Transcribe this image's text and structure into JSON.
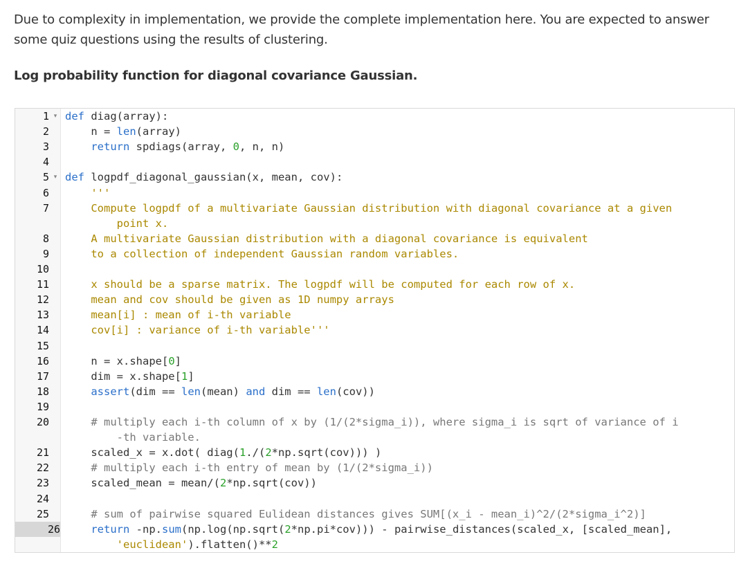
{
  "intro": {
    "line1": "Due to complexity in implementation, we provide the complete implementation here. You are expected to answer",
    "line2": "some quiz questions using the results of clustering."
  },
  "section_title": "Log probability function for diagonal covariance Gaussian.",
  "editor": {
    "active_line": "26",
    "lines": [
      {
        "n": "1",
        "fold": "▾",
        "text": "def diag(array):"
      },
      {
        "n": "2",
        "fold": "",
        "text": "    n = len(array)"
      },
      {
        "n": "3",
        "fold": "",
        "text": "    return spdiags(array, 0, n, n)"
      },
      {
        "n": "4",
        "fold": "",
        "text": ""
      },
      {
        "n": "5",
        "fold": "▾",
        "text": "def logpdf_diagonal_gaussian(x, mean, cov):"
      },
      {
        "n": "6",
        "fold": "",
        "text": "    '''"
      },
      {
        "n": "7",
        "fold": "",
        "text": "    Compute logpdf of a multivariate Gaussian distribution with diagonal covariance at a given"
      },
      {
        "n": "",
        "fold": "",
        "text": "        point x."
      },
      {
        "n": "8",
        "fold": "",
        "text": "    A multivariate Gaussian distribution with a diagonal covariance is equivalent"
      },
      {
        "n": "9",
        "fold": "",
        "text": "    to a collection of independent Gaussian random variables."
      },
      {
        "n": "10",
        "fold": "",
        "text": ""
      },
      {
        "n": "11",
        "fold": "",
        "text": "    x should be a sparse matrix. The logpdf will be computed for each row of x."
      },
      {
        "n": "12",
        "fold": "",
        "text": "    mean and cov should be given as 1D numpy arrays"
      },
      {
        "n": "13",
        "fold": "",
        "text": "    mean[i] : mean of i-th variable"
      },
      {
        "n": "14",
        "fold": "",
        "text": "    cov[i] : variance of i-th variable'''"
      },
      {
        "n": "15",
        "fold": "",
        "text": ""
      },
      {
        "n": "16",
        "fold": "",
        "text": "    n = x.shape[0]"
      },
      {
        "n": "17",
        "fold": "",
        "text": "    dim = x.shape[1]"
      },
      {
        "n": "18",
        "fold": "",
        "text": "    assert(dim == len(mean) and dim == len(cov))"
      },
      {
        "n": "19",
        "fold": "",
        "text": ""
      },
      {
        "n": "20",
        "fold": "",
        "text": "    # multiply each i-th column of x by (1/(2*sigma_i)), where sigma_i is sqrt of variance of i"
      },
      {
        "n": "",
        "fold": "",
        "text": "        -th variable."
      },
      {
        "n": "21",
        "fold": "",
        "text": "    scaled_x = x.dot( diag(1./(2*np.sqrt(cov))) )"
      },
      {
        "n": "22",
        "fold": "",
        "text": "    # multiply each i-th entry of mean by (1/(2*sigma_i))"
      },
      {
        "n": "23",
        "fold": "",
        "text": "    scaled_mean = mean/(2*np.sqrt(cov))"
      },
      {
        "n": "24",
        "fold": "",
        "text": ""
      },
      {
        "n": "25",
        "fold": "",
        "text": "    # sum of pairwise squared Eulidean distances gives SUM[(x_i - mean_i)^2/(2*sigma_i^2)]"
      },
      {
        "n": "26",
        "fold": "",
        "text": "    return -np.sum(np.log(np.sqrt(2*np.pi*cov))) - pairwise_distances(scaled_x, [scaled_mean],"
      },
      {
        "n": "",
        "fold": "",
        "text": "        'euclidean').flatten()**2"
      }
    ]
  }
}
